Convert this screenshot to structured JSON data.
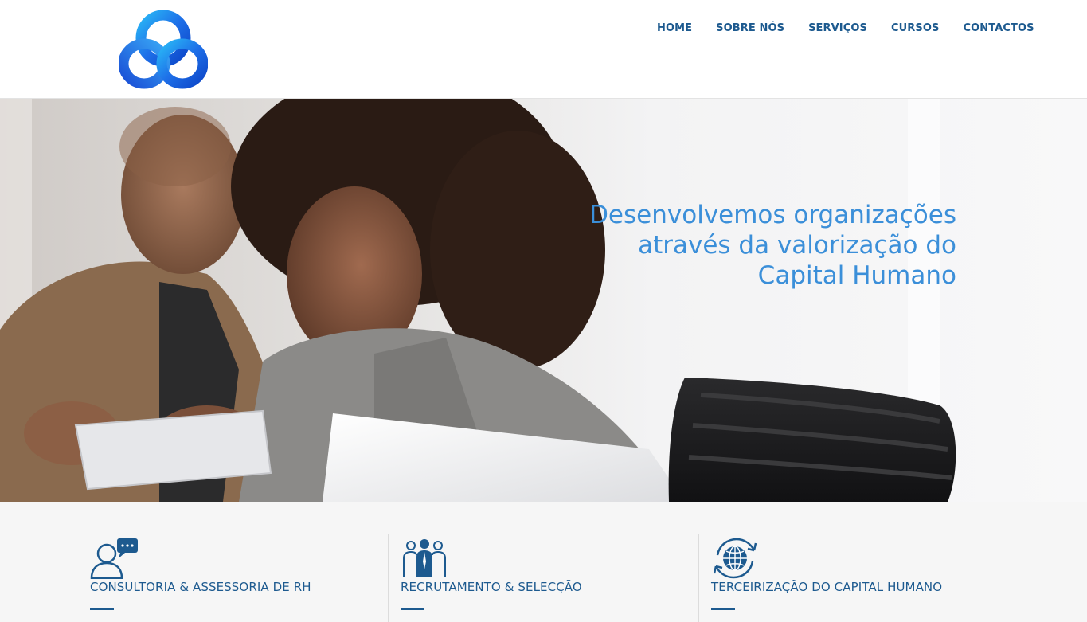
{
  "nav": {
    "items": [
      {
        "label": "HOME"
      },
      {
        "label": "SOBRE NÓS"
      },
      {
        "label": "SERVIÇOS"
      },
      {
        "label": "CURSOS"
      },
      {
        "label": "CONTACTOS"
      }
    ]
  },
  "hero": {
    "tagline_line1": "Desenvolvemos organizações",
    "tagline_line2": "através da valorização do",
    "tagline_line3": "Capital Humano"
  },
  "services": [
    {
      "title": "CONSULTORIA & ASSESSORIA DE RH",
      "icon": "consultant-chat-icon"
    },
    {
      "title": "RECRUTAMENTO & SELECÇÃO",
      "icon": "team-people-icon"
    },
    {
      "title": "TERCEIRIZAÇÃO DO CAPITAL HUMANO",
      "icon": "globe-cycle-icon"
    }
  ],
  "colors": {
    "nav_text": "#1d5a8f",
    "tagline": "#3b8fd9",
    "logo_blue": "#1565e0"
  }
}
